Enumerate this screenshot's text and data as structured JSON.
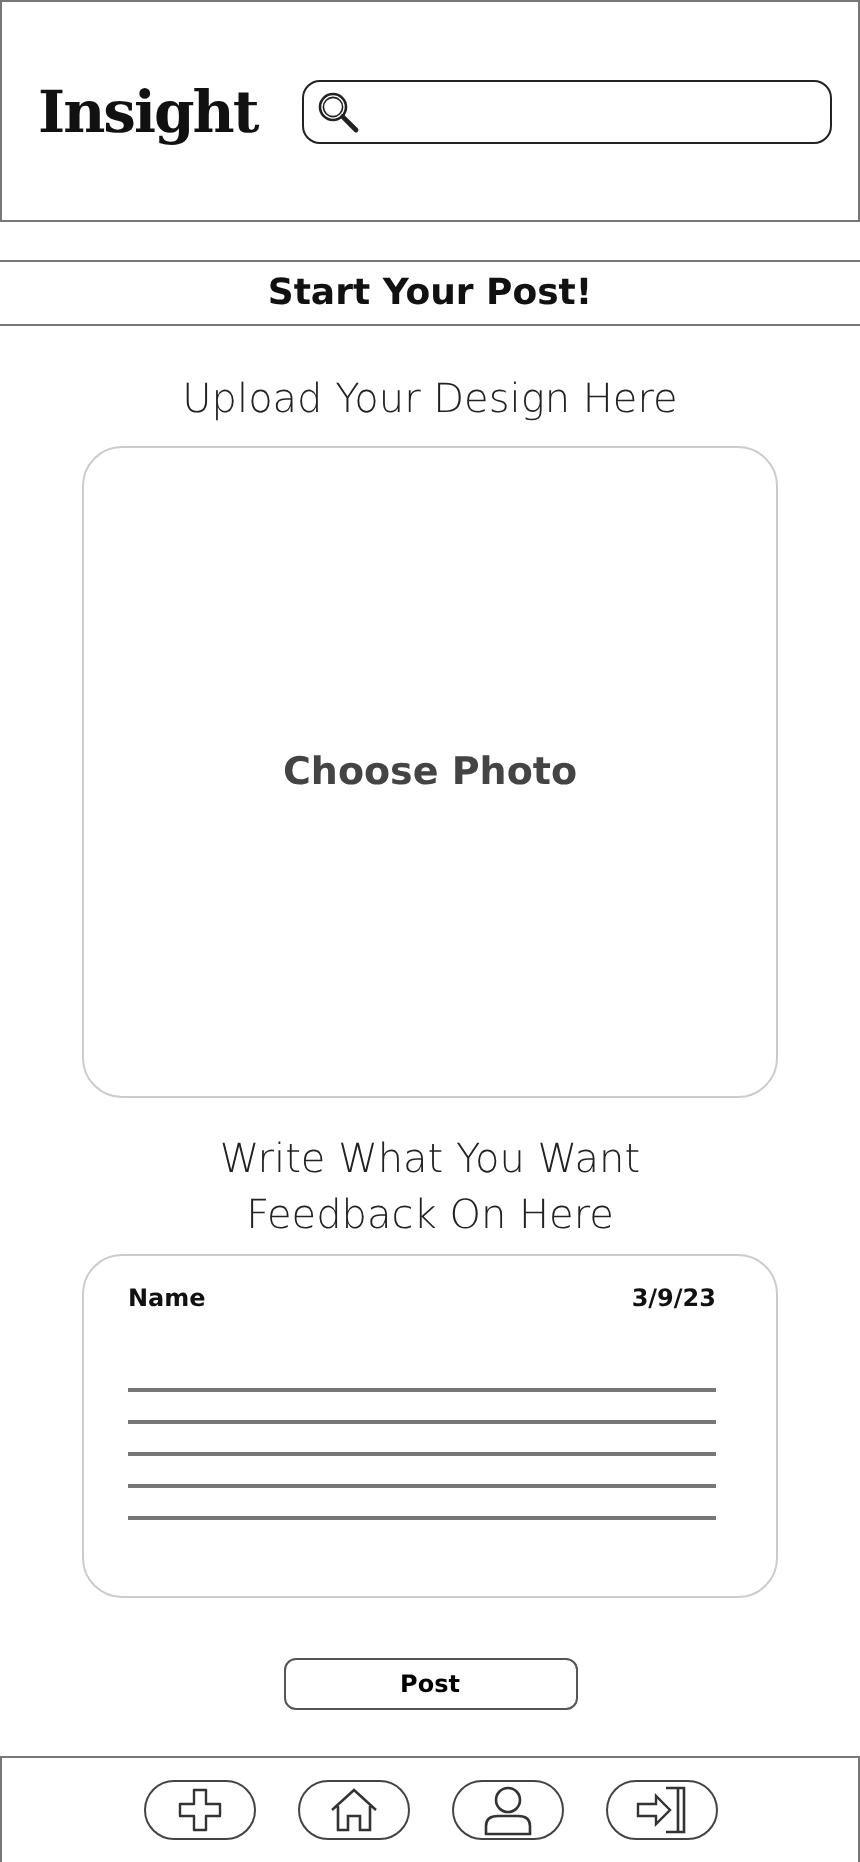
{
  "header": {
    "logo": "Insight"
  },
  "page_title": "Start Your Post!",
  "upload": {
    "heading": "Upload Your Design Here",
    "button": "Choose Photo"
  },
  "feedback": {
    "heading": "Write What You Want Feedback On Here",
    "name_label": "Name",
    "date": "3/9/23"
  },
  "post_button": "Post",
  "nav": [
    {
      "kind": "plus"
    },
    {
      "kind": "home"
    },
    {
      "kind": "person"
    },
    {
      "kind": "exit"
    }
  ]
}
